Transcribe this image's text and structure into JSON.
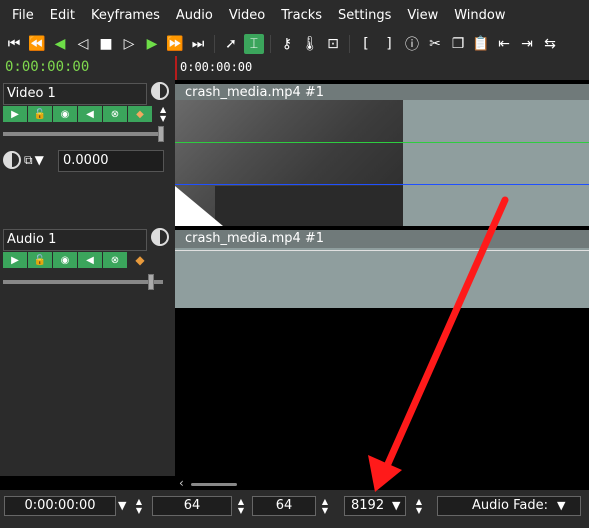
{
  "menu": [
    "File",
    "Edit",
    "Keyframes",
    "Audio",
    "Video",
    "Tracks",
    "Settings",
    "View",
    "Window"
  ],
  "toolbar": {
    "icons": [
      "skip-start-icon",
      "rewind-icon",
      "play-reverse-icon",
      "step-back-icon",
      "stop-icon",
      "step-forward-icon",
      "play-icon",
      "fast-forward-icon",
      "skip-end-icon",
      "select-tool-icon",
      "razor-tool-icon",
      "key-icon",
      "thermometer-icon",
      "lock-icon",
      "bracket-in-icon",
      "bracket-out-icon",
      "info-icon",
      "cut-icon",
      "copy-icon",
      "paste-icon",
      "insert-before-icon",
      "insert-after-icon",
      "replace-icon",
      "export-icon"
    ]
  },
  "time_header": {
    "current_time": "0:00:00:00",
    "ruler_time": "0:00:00:00"
  },
  "tracks": {
    "video": {
      "name": "Video 1",
      "composite_value": "0.0000",
      "clip_name": "crash_media.mp4 #1"
    },
    "audio": {
      "name": "Audio 1",
      "clip_name": "crash_media.mp4 #1"
    }
  },
  "bottom": {
    "time": "0:00:00:00",
    "value_a": "64",
    "value_b": "64",
    "value_c": "8192",
    "audio_fade": "Audio Fade:"
  },
  "colors": {
    "background": "#2b2b2b",
    "accent_green": "#3ba55c",
    "timecode_green": "#7fd84e",
    "clip_body": "#8f9e9e",
    "annotation_red": "#ff1a1a"
  }
}
